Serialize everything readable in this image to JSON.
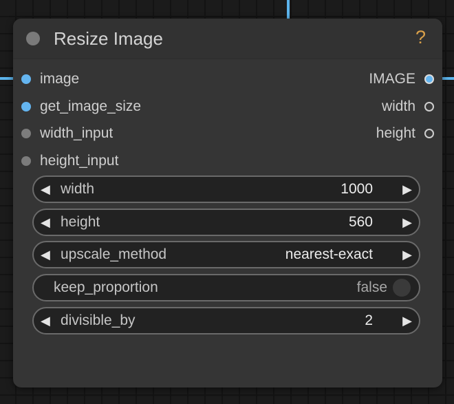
{
  "node": {
    "title": "Resize Image",
    "help": "?"
  },
  "inputs": [
    {
      "label": "image",
      "connected": true
    },
    {
      "label": "get_image_size",
      "connected": true
    },
    {
      "label": "width_input",
      "connected": false
    },
    {
      "label": "height_input",
      "connected": false
    }
  ],
  "outputs": [
    {
      "label": "IMAGE",
      "connected": true
    },
    {
      "label": "width",
      "connected": false
    },
    {
      "label": "height",
      "connected": false
    }
  ],
  "widgets": {
    "width": {
      "label": "width",
      "value": "1000"
    },
    "height": {
      "label": "height",
      "value": "560"
    },
    "upscale_method": {
      "label": "upscale_method",
      "value": "nearest-exact"
    },
    "keep_proportion": {
      "label": "keep_proportion",
      "value": "false"
    },
    "divisible_by": {
      "label": "divisible_by",
      "value": "2"
    }
  },
  "icons": {
    "decrement": "◀",
    "increment": "▶"
  },
  "colors": {
    "connected_slot": "#64b5f0",
    "wire": "#5cb4ec",
    "help": "#d9a04a"
  }
}
